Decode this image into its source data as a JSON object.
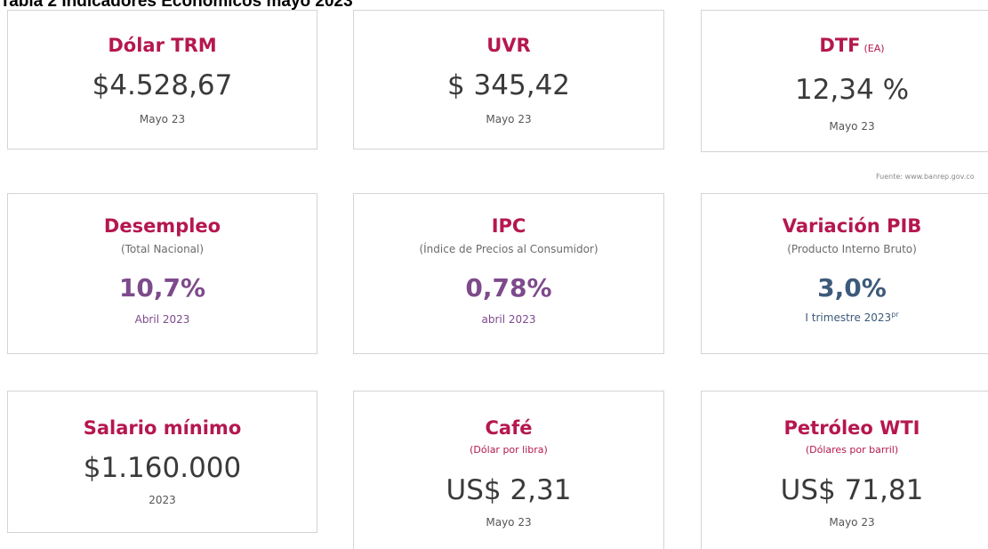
{
  "title": "Tabla 2 Indicadores Económicos  mayo 2023",
  "source": "Fuente: www.banrep.gov.co",
  "colors": {
    "title_accent": "#b5174f",
    "value_purple": "#7d4a8c",
    "value_blue": "#3d5a7a",
    "value_default": "#3a3a3a"
  },
  "cards": {
    "dolar": {
      "title": "Dólar TRM",
      "value": "$4.528,67",
      "date": "Mayo 23"
    },
    "uvr": {
      "title": "UVR",
      "value": "$ 345,42",
      "date": "Mayo 23"
    },
    "dtf": {
      "title": "DTF",
      "suffix": "(EA)",
      "value": "12,34 %",
      "date": "Mayo 23"
    },
    "desempleo": {
      "title": "Desempleo",
      "subtitle": "(Total Nacional)",
      "value": "10,7%",
      "date": "Abril 2023"
    },
    "ipc": {
      "title": "IPC",
      "subtitle": "(Índice de Precios al Consumidor)",
      "value": "0,78%",
      "date": "abril 2023"
    },
    "pib": {
      "title": "Variación PIB",
      "subtitle": "(Producto Interno Bruto)",
      "value": "3,0%",
      "date": "I trimestre 2023",
      "date_sup": "pr"
    },
    "salario": {
      "title": "Salario mínimo",
      "value": "$1.160.000",
      "date": "2023"
    },
    "cafe": {
      "title": "Café",
      "subtitle": "(Dólar por libra)",
      "value": "US$ 2,31",
      "date": "Mayo 23"
    },
    "petroleo": {
      "title": "Petróleo WTI",
      "subtitle": "(Dólares por barril)",
      "value": "US$ 71,81",
      "date": "Mayo 23"
    }
  }
}
